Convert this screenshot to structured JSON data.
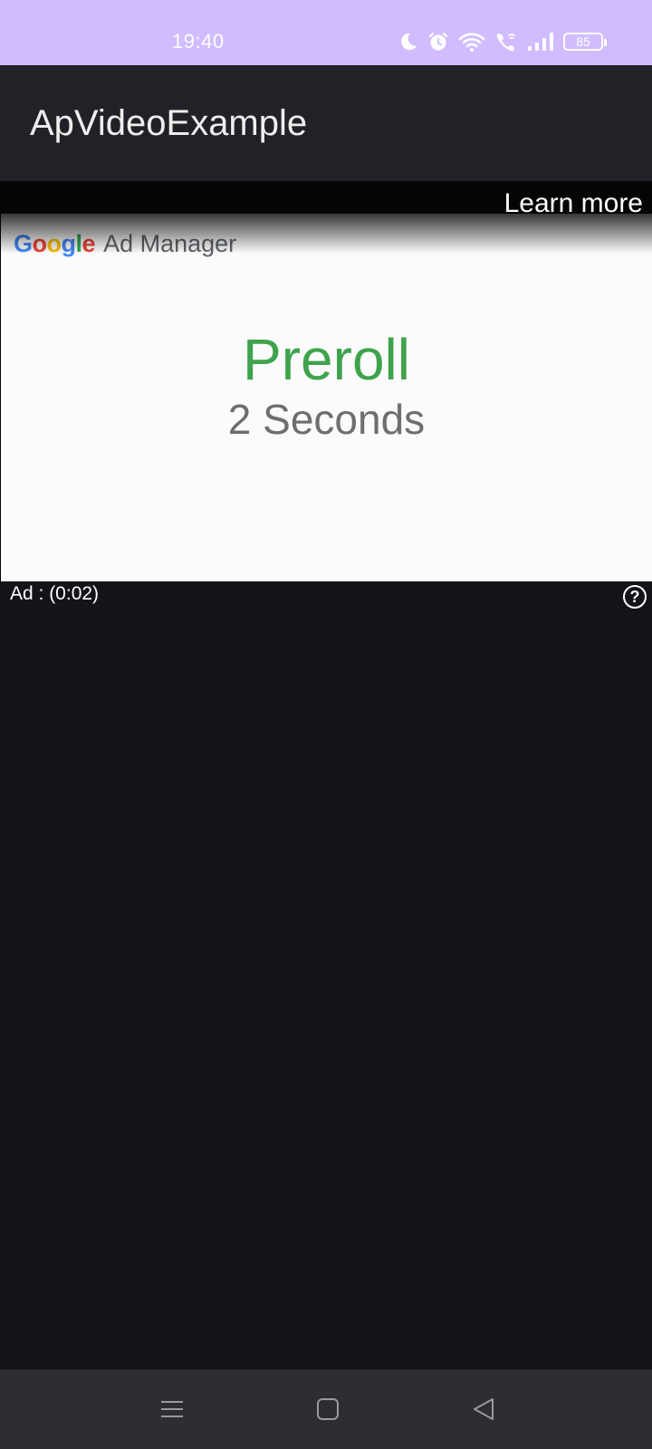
{
  "status_bar": {
    "time": "19:40",
    "battery_level": "85",
    "icons": [
      "moon-icon",
      "alarm-icon",
      "wifi-icon",
      "wifi-calling-icon",
      "signal-icon",
      "battery-icon"
    ]
  },
  "app_bar": {
    "title": "ApVideoExample"
  },
  "player": {
    "learn_more_label": "Learn more",
    "ad_countdown": "Ad : (0:02)",
    "help_icon_glyph": "?",
    "creative": {
      "logo_word_google": [
        "G",
        "o",
        "o",
        "g",
        "l",
        "e"
      ],
      "logo_product": "Ad Manager",
      "headline": "Preroll",
      "subline": "2 Seconds"
    }
  },
  "nav_bar": {
    "buttons": [
      "menu-icon",
      "home-icon",
      "back-icon"
    ]
  },
  "colors": {
    "status_bar_bg": "#d0bcff",
    "app_bar_bg": "#222127",
    "content_bg": "#15131a",
    "headline_green": "#3fa34d",
    "nav_bar_bg": "#2e2d32"
  }
}
